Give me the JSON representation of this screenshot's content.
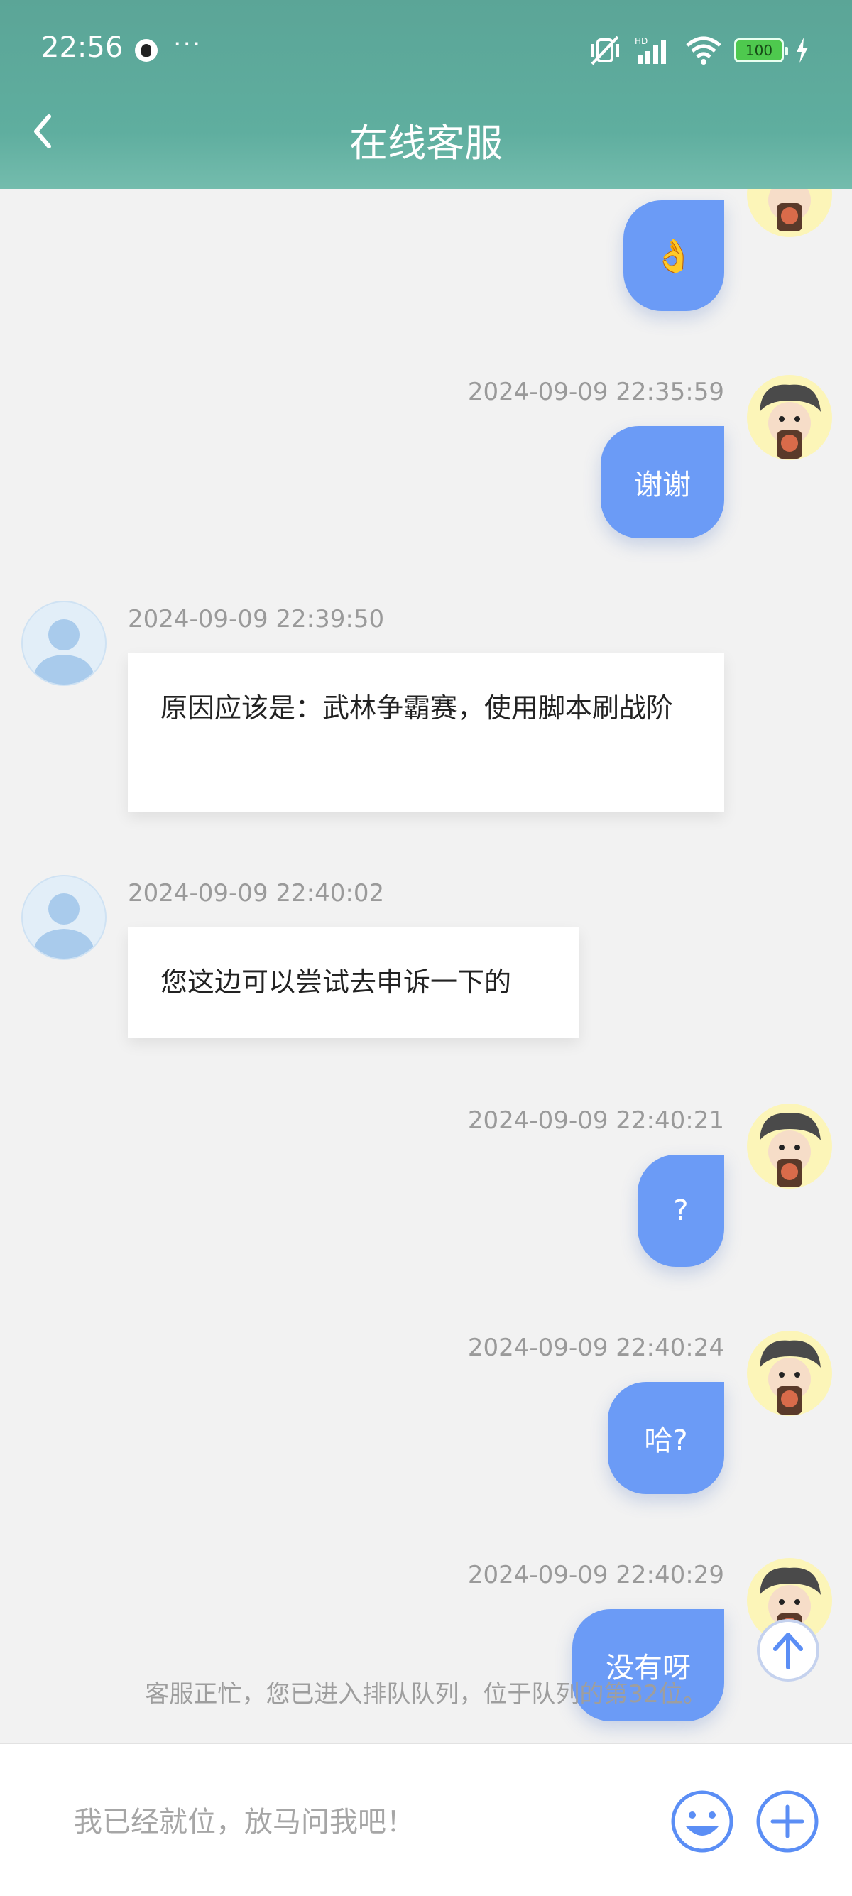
{
  "status_bar": {
    "time": "22:56",
    "more": "···",
    "battery": "100"
  },
  "header": {
    "title": "在线客服"
  },
  "messages": [
    {
      "sender": "user",
      "type": "emoji",
      "content": "👌"
    },
    {
      "sender": "user",
      "time": "2024-09-09 22:35:59",
      "text": "谢谢"
    },
    {
      "sender": "agent",
      "time": "2024-09-09 22:39:50",
      "text": "原因应该是：武林争霸赛，使用脚本刷战阶"
    },
    {
      "sender": "agent",
      "time": "2024-09-09 22:40:02",
      "text": "您这边可以尝试去申诉一下的"
    },
    {
      "sender": "user",
      "time": "2024-09-09 22:40:21",
      "text": "?"
    },
    {
      "sender": "user",
      "time": "2024-09-09 22:40:24",
      "text": "哈?"
    },
    {
      "sender": "user",
      "time": "2024-09-09 22:40:29",
      "text": "没有呀"
    }
  ],
  "queue_notice": "客服正忙，您已进入排队队列，位于队列的第32位。",
  "input": {
    "placeholder": "我已经就位，放马问我吧！"
  },
  "colors": {
    "header": "#5fae9f",
    "user_bubble": "#6b9bf6",
    "agent_bubble": "#ffffff",
    "accent": "#5b8ef5"
  }
}
